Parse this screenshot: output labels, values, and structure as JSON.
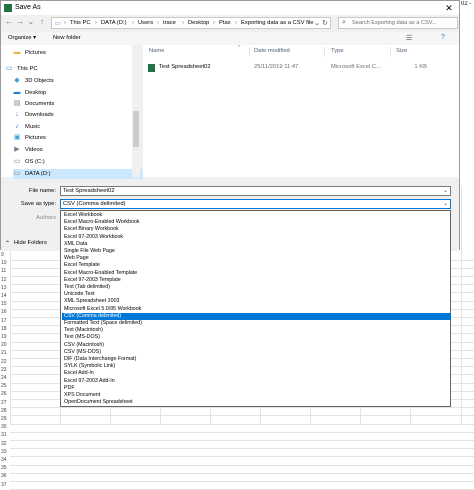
{
  "window": {
    "title": "Save As",
    "close_glyph": "✕"
  },
  "address": {
    "segments": [
      "This PC",
      "DATA (D:)",
      "Users",
      "trace",
      "Desktop",
      "Ptax",
      "Exporting data as a CSV file"
    ],
    "separator": "›",
    "search_placeholder": "Search Exporting data as a CSV..."
  },
  "toolbar": {
    "organize": "Organize ▾",
    "new_folder": "New folder"
  },
  "nav": {
    "items": [
      {
        "label": "Pictures",
        "icon": "folder-icon",
        "glyph": "▬",
        "color": "#e8b84a"
      },
      {
        "label": "This PC",
        "icon": "pc-icon",
        "glyph": "▭",
        "color": "#2a7fd4"
      },
      {
        "label": "3D Objects",
        "icon": "cube-icon",
        "glyph": "◆",
        "color": "#3aa0e0"
      },
      {
        "label": "Desktop",
        "icon": "desktop-icon",
        "glyph": "▬",
        "color": "#2a7fd4"
      },
      {
        "label": "Documents",
        "icon": "document-icon",
        "glyph": "▤",
        "color": "#6b7f99"
      },
      {
        "label": "Downloads",
        "icon": "download-icon",
        "glyph": "↓",
        "color": "#2a7fd4"
      },
      {
        "label": "Music",
        "icon": "music-icon",
        "glyph": "♪",
        "color": "#2a7fd4"
      },
      {
        "label": "Pictures",
        "icon": "pictures-icon",
        "glyph": "▣",
        "color": "#3aa0e0"
      },
      {
        "label": "Videos",
        "icon": "video-icon",
        "glyph": "▶",
        "color": "#6b7f99"
      },
      {
        "label": "OS (C:)",
        "icon": "drive-icon",
        "glyph": "▭",
        "color": "#777777"
      },
      {
        "label": "DATA (D:)",
        "icon": "drive-icon",
        "glyph": "▭",
        "color": "#777777"
      }
    ]
  },
  "files": {
    "columns": [
      "Name",
      "Date modified",
      "Type",
      "Size"
    ],
    "rows": [
      {
        "name": "Test Spreadsheet02",
        "date": "25/11/2019 11:47",
        "type": "Microsoft Excel C...",
        "size": "1 KB"
      }
    ]
  },
  "form": {
    "file_name_label": "File name:",
    "file_name_value": "Test Spreadsheet02",
    "save_type_label": "Save as type:",
    "save_type_value": "CSV (Comma delimited)",
    "authors_label": "Authors",
    "hide_folders": "Hide Folders"
  },
  "type_options": [
    "Excel Workbook",
    "Excel Macro-Enabled Workbook",
    "Excel Binary Workbook",
    "Excel 97-2003 Workbook",
    "XML Data",
    "Single File Web Page",
    "Web Page",
    "Excel Template",
    "Excel Macro-Enabled Template",
    "Excel 97-2003 Template",
    "Text (Tab delimited)",
    "Unicode Text",
    "XML Spreadsheet 2003",
    "Microsoft Excel 5.0/95 Workbook",
    "CSV (Comma delimited)",
    "Formatted Text (Space delimited)",
    "Text (Macintosh)",
    "Text (MS-DOS)",
    "CSV (Macintosh)",
    "CSV (MS-DOS)",
    "DIF (Data Interchange Format)",
    "SYLK (Symbolic Link)",
    "Excel Add-In",
    "Excel 97-2003 Add-In",
    "PDF",
    "XPS Document",
    "OpenDocument Spreadsheet"
  ],
  "selected_option": "CSV (Comma delimited)",
  "sheet": {
    "row_numbers": [
      "9",
      "10",
      "11",
      "12",
      "13",
      "14",
      "15",
      "16",
      "17",
      "18",
      "19",
      "20",
      "21",
      "22",
      "23",
      "24",
      "25",
      "26",
      "27",
      "28",
      "29",
      "30",
      "31",
      "32",
      "33",
      "34",
      "35",
      "36",
      "37"
    ],
    "corner_text": "02 -"
  },
  "colors": {
    "accent": "#0078d7",
    "dialog_bg": "#f0f0f0"
  }
}
